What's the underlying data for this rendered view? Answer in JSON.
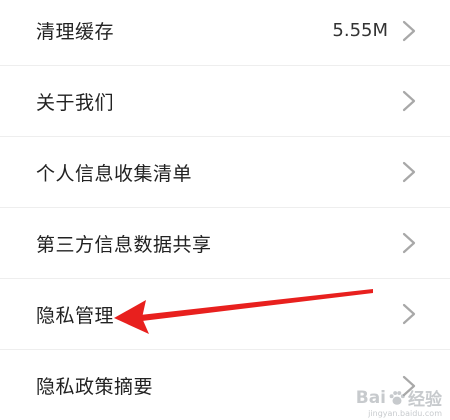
{
  "settings_list": {
    "items": [
      {
        "label": "清理缓存",
        "value": "5.55M",
        "icon": "chevron-right-icon"
      },
      {
        "label": "关于我们",
        "value": "",
        "icon": "chevron-right-icon"
      },
      {
        "label": "个人信息收集清单",
        "value": "",
        "icon": "chevron-right-icon"
      },
      {
        "label": "第三方信息数据共享",
        "value": "",
        "icon": "chevron-right-icon"
      },
      {
        "label": "隐私管理",
        "value": "",
        "icon": "chevron-right-icon"
      },
      {
        "label": "隐私政策摘要",
        "value": "",
        "icon": "chevron-right-icon"
      }
    ]
  },
  "annotation": {
    "type": "arrow",
    "color": "#e8201e",
    "points_to": "隐私管理"
  },
  "watermark": {
    "brand_left": "Bai",
    "brand_right": "经验",
    "url": "jingyan.baidu.com"
  },
  "colors": {
    "text": "#222222",
    "chevron": "#a8a8a8",
    "divider": "#eeeeee"
  }
}
